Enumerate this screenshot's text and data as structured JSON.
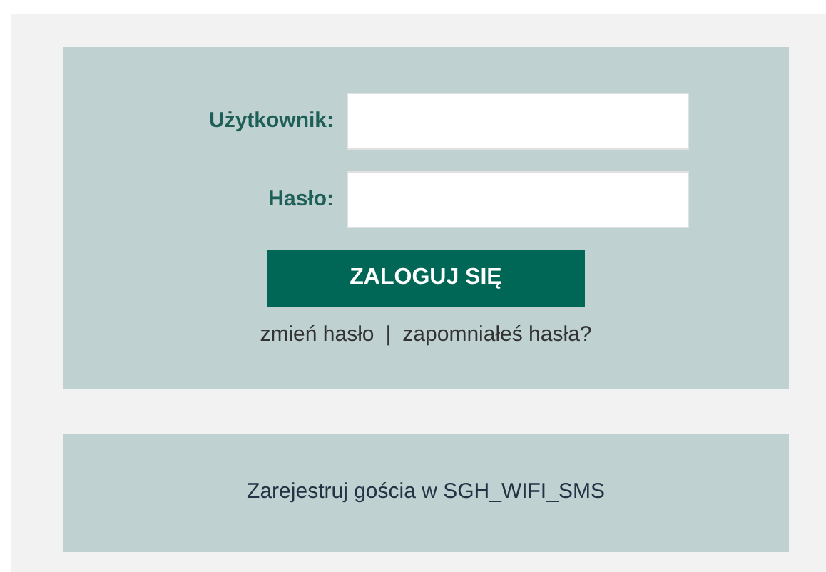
{
  "login": {
    "fields": [
      {
        "label": "Użytkownik:"
      },
      {
        "label": "Hasło:"
      }
    ],
    "submit": "ZALOGUJ SIĘ",
    "links": [
      "zmień hasło",
      "zapomniałeś hasła?"
    ],
    "separator": "|"
  },
  "guest": {
    "link": "Zarejestruj gościa w SGH_WIFI_SMS"
  }
}
